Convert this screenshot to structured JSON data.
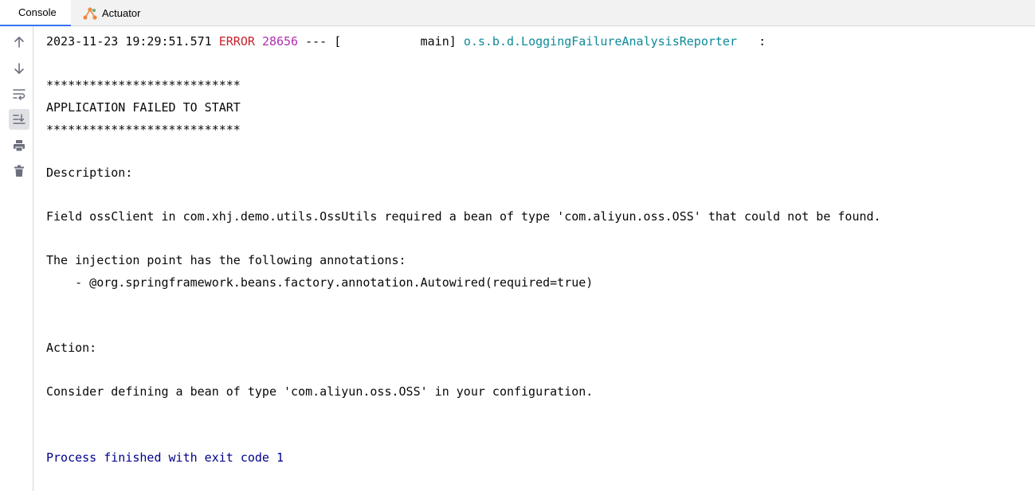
{
  "tabs": [
    {
      "label": "Console",
      "active": true
    },
    {
      "label": "Actuator",
      "icon": "actuator-icon",
      "active": false
    }
  ],
  "toolbar": [
    {
      "icon": "arrow-up-icon",
      "tooltip": "Up the Stack Trace"
    },
    {
      "icon": "arrow-down-icon",
      "tooltip": "Down the Stack Trace"
    },
    {
      "icon": "soft-wrap-icon",
      "tooltip": "Soft-Wrap"
    },
    {
      "icon": "scroll-to-end-icon",
      "tooltip": "Scroll to the End",
      "active": true
    },
    {
      "icon": "print-icon",
      "tooltip": "Print"
    },
    {
      "icon": "trash-icon",
      "tooltip": "Clear All"
    }
  ],
  "log_header": {
    "timestamp": "2023-11-23 19:29:51.571",
    "level": "ERROR",
    "pid": "28656",
    "separator": "--- [",
    "thread": "           main]",
    "logger": "o.s.b.d.LoggingFailureAnalysisReporter",
    "tail": "   :"
  },
  "lines": {
    "stars_top": "***************************",
    "failed": "APPLICATION FAILED TO START",
    "stars_bottom": "***************************",
    "description": "Description:",
    "field": "Field ossClient in com.xhj.demo.utils.OssUtils required a bean of type 'com.aliyun.oss.OSS' that could not be found.",
    "injection": "The injection point has the following annotations:",
    "annotation": "\t- @org.springframework.beans.factory.annotation.Autowired(required=true)",
    "action": "Action:",
    "consider": "Consider defining a bean of type 'com.aliyun.oss.OSS' in your configuration.",
    "exit": "Process finished with exit code 1"
  },
  "colors": {
    "error": "#c7222d",
    "pid": "#b22eb2",
    "logger": "#0e8a9a",
    "exit": "#00008b",
    "accent": "#3574f0"
  }
}
